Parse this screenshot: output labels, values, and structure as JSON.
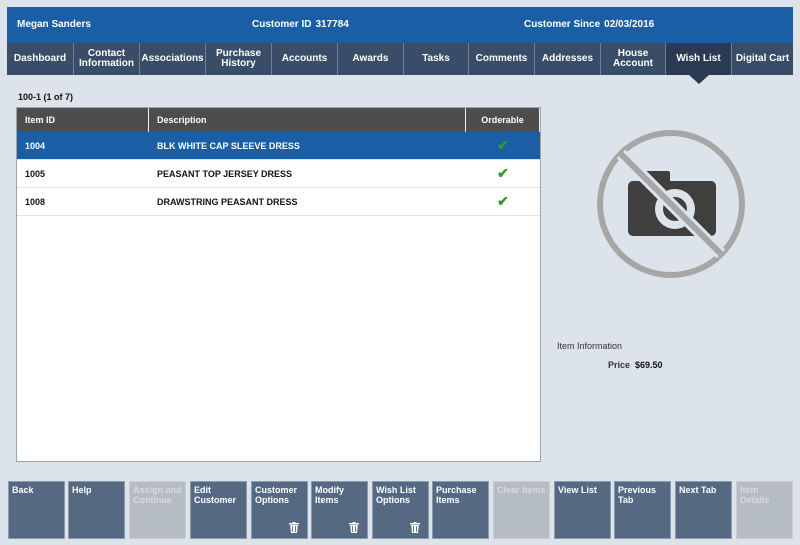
{
  "header": {
    "customer_name": "Megan Sanders",
    "customer_id_label": "Customer ID",
    "customer_id": "317784",
    "customer_since_label": "Customer Since",
    "customer_since": "02/03/2016"
  },
  "tabs": [
    {
      "label": "Dashboard",
      "active": false
    },
    {
      "label": "Contact Information",
      "active": false
    },
    {
      "label": "Associations",
      "active": false
    },
    {
      "label": "Purchase History",
      "active": false
    },
    {
      "label": "Accounts",
      "active": false
    },
    {
      "label": "Awards",
      "active": false
    },
    {
      "label": "Tasks",
      "active": false
    },
    {
      "label": "Comments",
      "active": false
    },
    {
      "label": "Addresses",
      "active": false
    },
    {
      "label": "House Account",
      "active": false
    },
    {
      "label": "Wish List",
      "active": true
    },
    {
      "label": "Digital Cart",
      "active": false
    }
  ],
  "pager": "100-1 (1 of 7)",
  "table": {
    "headers": [
      "Item ID",
      "Description",
      "Orderable"
    ],
    "rows": [
      {
        "item_id": "1004",
        "description": "BLK WHITE CAP SLEEVE DRESS",
        "orderable": "✔",
        "selected": true
      },
      {
        "item_id": "1005",
        "description": "PEASANT TOP JERSEY DRESS",
        "orderable": "✔",
        "selected": false
      },
      {
        "item_id": "1008",
        "description": "DRAWSTRING PEASANT DRESS",
        "orderable": "✔",
        "selected": false
      }
    ]
  },
  "item_info": {
    "title": "Item Information",
    "price_label": "Price",
    "price": "$69.50"
  },
  "footer_buttons": [
    {
      "label": "Back",
      "enabled": true,
      "trash": false
    },
    {
      "label": "Help",
      "enabled": true,
      "trash": false
    },
    {
      "label": "Assign and Continue",
      "enabled": false,
      "trash": false
    },
    {
      "label": "Edit Customer",
      "enabled": true,
      "trash": false
    },
    {
      "label": "Customer Options",
      "enabled": true,
      "trash": true
    },
    {
      "label": "Modify Items",
      "enabled": true,
      "trash": true
    },
    {
      "label": "Wish List Options",
      "enabled": true,
      "trash": true
    },
    {
      "label": "Purchase Items",
      "enabled": true,
      "trash": false
    },
    {
      "label": "Clear Items",
      "enabled": false,
      "trash": false
    },
    {
      "label": "View List",
      "enabled": true,
      "trash": false
    },
    {
      "label": "Previous Tab",
      "enabled": true,
      "trash": false
    },
    {
      "label": "Next Tab",
      "enabled": true,
      "trash": false
    },
    {
      "label": "Item Details",
      "enabled": false,
      "trash": false
    }
  ],
  "colors": {
    "header_bg": "#1a5fa6",
    "tab_bg": "#3a4d68",
    "selected_row": "#1a5fa6",
    "check": "#2a9d2a",
    "button_bg": "#556a82"
  }
}
